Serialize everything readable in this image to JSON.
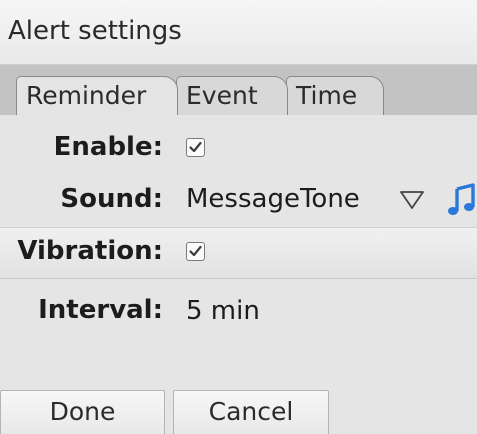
{
  "window": {
    "title": "Alert settings"
  },
  "tabs": [
    {
      "label": "Reminder",
      "active": true
    },
    {
      "label": "Event",
      "active": false
    },
    {
      "label": "Time",
      "active": false
    }
  ],
  "fields": {
    "enable": {
      "label": "Enable:",
      "checked": true
    },
    "sound": {
      "label": "Sound:",
      "value": "MessageTone",
      "icons": [
        "dropdown-triangle-icon",
        "music-note-icon"
      ]
    },
    "vibration": {
      "label": "Vibration:",
      "checked": true
    },
    "interval": {
      "label": "Interval:",
      "value": "5 min"
    }
  },
  "buttons": {
    "done": "Done",
    "cancel": "Cancel"
  },
  "colors": {
    "accent": "#2a78d8",
    "panel": "#e5e5e5",
    "tabstrip": "#c3c3c3"
  }
}
